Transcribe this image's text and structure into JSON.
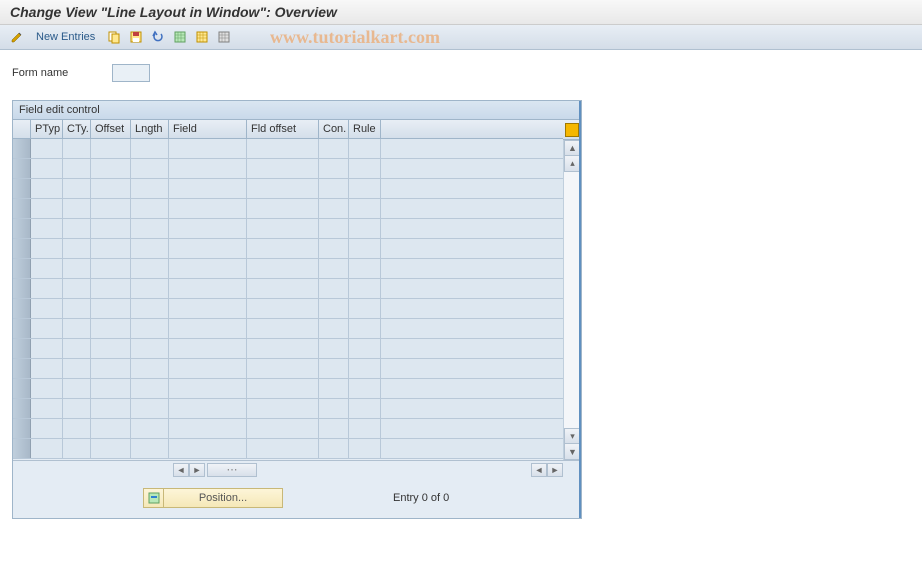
{
  "title": "Change View \"Line Layout in Window\": Overview",
  "toolbar": {
    "new_entries": "New Entries"
  },
  "watermark": "www.tutorialkart.com",
  "form": {
    "name_label": "Form name",
    "name_value": ""
  },
  "panel": {
    "header": "Field edit control",
    "columns": {
      "ptyp": "PTyp",
      "cty": "CTy.",
      "offset": "Offset",
      "lngth": "Lngth",
      "field": "Field",
      "fld_offset": "Fld offset",
      "con": "Con.",
      "rule": "Rule"
    },
    "row_count": 16
  },
  "footer": {
    "position_label": "Position...",
    "entry_text": "Entry 0 of 0"
  },
  "icons": {
    "pencil": "pencil-icon",
    "copy": "copy-icon",
    "save": "save-icon",
    "undo": "undo-icon",
    "select_all": "select-all-icon",
    "deselect": "deselect-icon",
    "table": "table-icon"
  }
}
